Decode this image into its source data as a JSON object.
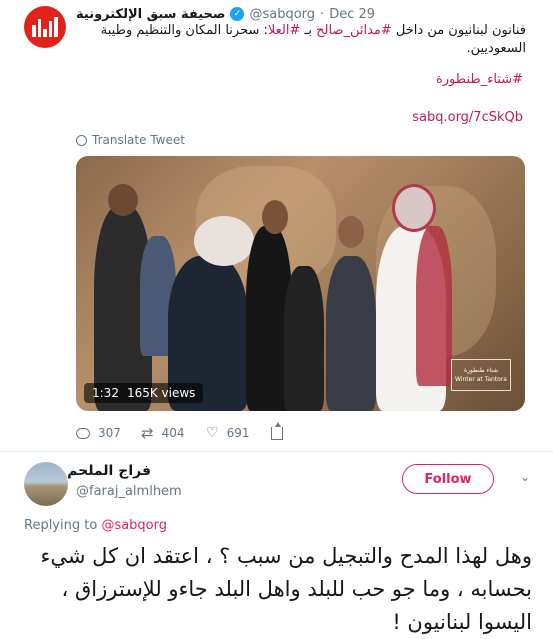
{
  "tweet": {
    "author_name": "صحيفة سبق الإلكترونية",
    "handle": "@sabqorg",
    "separator": "·",
    "date": "Dec 29",
    "text_before": "فنانون لبنانيون من داخل ",
    "tag_madain": "#مدائن_صالح",
    "text_mid": " بـ ",
    "tag_ula": "#العلا",
    "text_after": ": سحرنا المكان والتنظيم وطيبة السعوديين.",
    "hashtag_tantora": "#شتاء_طنطورة",
    "link": "sabq.org/7cSkQb",
    "translate": "Translate Tweet",
    "video": {
      "duration": "1:32",
      "views": "165K views",
      "watermark_ar": "شتاء طنطورة",
      "watermark_en": "Winter at Tantora"
    },
    "actions": {
      "replies": "307",
      "retweets": "404",
      "likes": "691"
    }
  },
  "reply": {
    "author_name": "فراج الملحم",
    "handle": "@faraj_almlhem",
    "follow_label": "Follow",
    "replying_prefix": "Replying to ",
    "replying_to": "@sabqorg",
    "text": "وهل لهذا المدح والتبجيل من سبب ؟ ، اعتقد ان كل شيء بحسابه ، وما جو حب للبلد واهل البلد جاءو للإسترزاق ، اليسوا لبنانيون !"
  },
  "colors": {
    "accent_pink": "#e0245e",
    "hashtag": "#c2185b",
    "verified_blue": "#1da1f2",
    "muted": "#657786",
    "logo_red": "#e0241b"
  }
}
